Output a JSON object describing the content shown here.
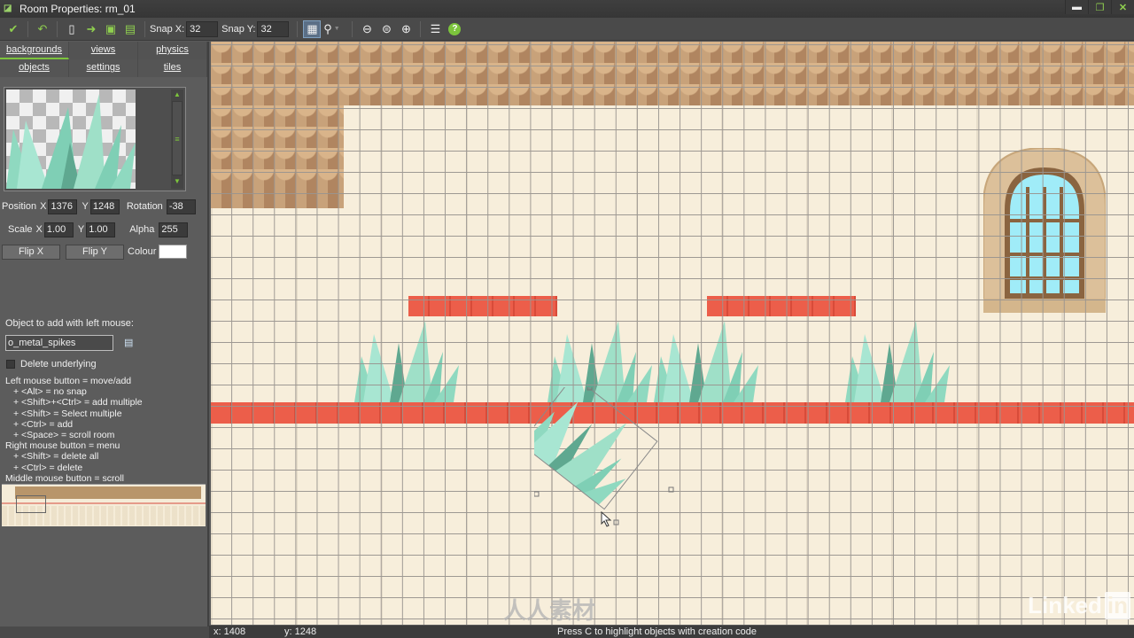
{
  "window": {
    "title": "Room Properties: rm_01",
    "app_icon": "room-icon",
    "controls": [
      "minimize",
      "restore",
      "close"
    ]
  },
  "toolbar": {
    "buttons": [
      {
        "name": "confirm",
        "icon": "checkmark-icon",
        "glyph": "✔"
      },
      {
        "name": "undo",
        "icon": "undo-icon",
        "glyph": "↶"
      },
      {
        "name": "clear",
        "icon": "new-page-icon",
        "glyph": "▯"
      },
      {
        "name": "shift",
        "icon": "arrow-right-icon",
        "glyph": "➜"
      },
      {
        "name": "lock",
        "icon": "lock-icon",
        "glyph": "🔒"
      },
      {
        "name": "unlock",
        "icon": "unlock-icon",
        "glyph": "🔓"
      }
    ],
    "snap_x_label": "Snap X:",
    "snap_x_value": "32",
    "snap_y_label": "Snap Y:",
    "snap_y_value": "32",
    "grid_toggle": "grid-icon",
    "highlight": "magnifier-icon",
    "zoom_out": "zoom-out-icon",
    "zoom_reset": "zoom-reset-icon",
    "zoom_in": "zoom-in-icon",
    "list": "list-icon",
    "help_glyph": "?"
  },
  "tabs": {
    "row1": [
      "backgrounds",
      "views",
      "physics"
    ],
    "row2": [
      "objects",
      "settings",
      "tiles"
    ],
    "active": "backgrounds"
  },
  "object_props": {
    "position_label": "Position",
    "x_label": "X",
    "y_label": "Y",
    "position_x": "1376",
    "position_y": "1248",
    "rotation_label": "Rotation",
    "rotation": "-38",
    "scale_label": "Scale",
    "scale_x": "1.00",
    "scale_y": "1.00",
    "alpha_label": "Alpha",
    "alpha": "255",
    "flip_x": "Flip X",
    "flip_y": "Flip Y",
    "colour_label": "Colour",
    "colour": "#ffffff"
  },
  "object_picker": {
    "label": "Object to add with left mouse:",
    "value": "o_metal_spikes",
    "delete_underlying_label": "Delete underlying",
    "delete_underlying": false
  },
  "help": [
    {
      "text": "Left mouse button = move/add",
      "indent": false
    },
    {
      "text": "+ <Alt> = no snap",
      "indent": true
    },
    {
      "text": "+ <Shift>+<Ctrl> = add multiple",
      "indent": true
    },
    {
      "text": "+ <Shift> = Select multiple",
      "indent": true
    },
    {
      "text": "+ <Ctrl> = add",
      "indent": true
    },
    {
      "text": "+ <Space> = scroll room",
      "indent": true
    },
    {
      "text": "Right mouse button = menu",
      "indent": false
    },
    {
      "text": "+ <Shift> = delete all",
      "indent": true
    },
    {
      "text": "+ <Ctrl> = delete",
      "indent": true
    },
    {
      "text": "Middle mouse button = scroll",
      "indent": false
    }
  ],
  "status": {
    "x": "x: 1408",
    "y": "y: 1248",
    "message": "Press C to highlight objects with creation code"
  },
  "room": {
    "colors": {
      "wall": "#f7eedb",
      "grid": "#9a9590",
      "red_platform": "#ec5e4a",
      "spikes": "#7fcfb5",
      "roof": "#c8a27a",
      "window_glass": "#8fe0f2"
    },
    "objects": [
      "roof-tiles",
      "red-platform",
      "red-platform",
      "red-ground-strip",
      "metal-spikes",
      "metal-spikes",
      "metal-spikes",
      "metal-spikes",
      "metal-spikes-selected",
      "arched-window"
    ]
  },
  "watermarks": {
    "brand": "Linked",
    "brand_box": "in",
    "site": "人人素材"
  }
}
